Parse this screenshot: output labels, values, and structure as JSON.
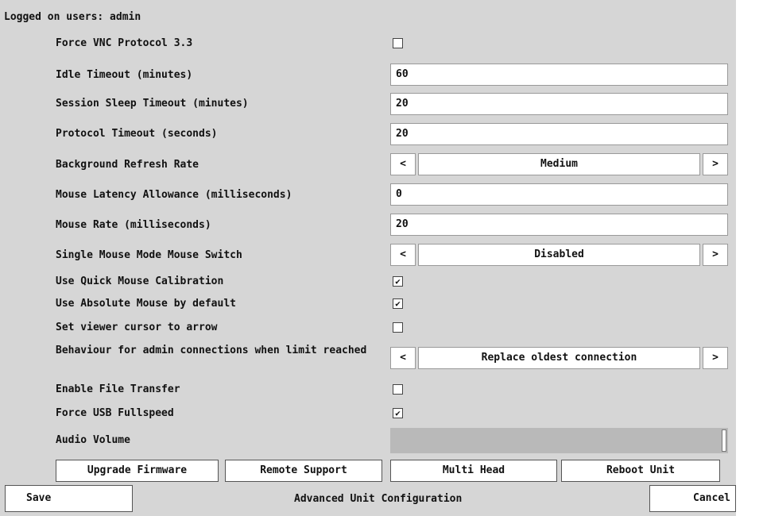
{
  "status": {
    "logged_on": "Logged on users: admin"
  },
  "settings": {
    "force_vnc": {
      "label": "Force VNC Protocol 3.3",
      "checked": false
    },
    "idle_timeout": {
      "label": "Idle Timeout (minutes)",
      "value": "60"
    },
    "session_sleep": {
      "label": "Session Sleep Timeout (minutes)",
      "value": "20"
    },
    "protocol_timeout": {
      "label": "Protocol Timeout (seconds)",
      "value": "20"
    },
    "bg_refresh": {
      "label": "Background Refresh Rate",
      "value": "Medium"
    },
    "mouse_latency": {
      "label": "Mouse Latency Allowance (milliseconds)",
      "value": "0"
    },
    "mouse_rate": {
      "label": "Mouse Rate (milliseconds)",
      "value": "20"
    },
    "single_mouse": {
      "label": "Single Mouse Mode Mouse Switch",
      "value": "Disabled"
    },
    "quick_calibration": {
      "label": "Use Quick Mouse Calibration",
      "checked": true
    },
    "absolute_mouse": {
      "label": "Use Absolute Mouse by default",
      "checked": true
    },
    "cursor_arrow": {
      "label": "Set viewer cursor to arrow",
      "checked": false
    },
    "admin_limit": {
      "label": "Behaviour for admin connections when limit reached",
      "value": "Replace oldest connection"
    },
    "file_transfer": {
      "label": "Enable File Transfer",
      "checked": false
    },
    "usb_fullspeed": {
      "label": "Force USB Fullspeed",
      "checked": true
    },
    "audio_volume": {
      "label": "Audio Volume",
      "level": 1.0
    }
  },
  "arrows": {
    "left": "<",
    "right": ">"
  },
  "check_mark": "✔",
  "buttons": {
    "upgrade": "Upgrade Firmware",
    "remote": "Remote Support",
    "multihead": "Multi Head",
    "reboot": "Reboot Unit"
  },
  "footer": {
    "save": "Save",
    "title": "Advanced Unit Configuration",
    "cancel": "Cancel"
  }
}
